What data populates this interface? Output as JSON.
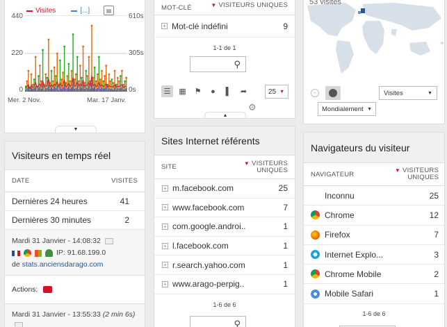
{
  "colors": {
    "accent": "#d4132a",
    "blue": "#255792",
    "visits_series": "#e86b0b",
    "unique_series": "#22b322",
    "dark_series": "#3d3d8f",
    "line_red": "#d4132a",
    "line_blue": "#4b83c3"
  },
  "evolution": {
    "legend_visits": "Visites",
    "legend_other": "[...]",
    "y_left_ticks": [
      "440",
      "220",
      "0"
    ],
    "y_right_ticks": [
      "610s",
      "305s",
      "0s"
    ],
    "x_ticks": [
      "Mer. 2 Nov.",
      "Mar. 17 Janv."
    ]
  },
  "chart_data": {
    "type": "bar",
    "title": "",
    "x_start": "Mer. 2 Nov.",
    "x_end": "Mar. 17 Janv.",
    "ylim": [
      0,
      440
    ],
    "y2lim": [
      0,
      610
    ],
    "series": [
      {
        "name": "Visites",
        "values": [
          30,
          60,
          120,
          20,
          100,
          40,
          70,
          200,
          30,
          90,
          150,
          60,
          240,
          40,
          100,
          80,
          300,
          50,
          120,
          60,
          140,
          90,
          220,
          40,
          180,
          70,
          110,
          260,
          50,
          90,
          160,
          60,
          120,
          330,
          70,
          100,
          200,
          60,
          150,
          80,
          260,
          50,
          120,
          90,
          200,
          60,
          380,
          80,
          140,
          60,
          100,
          200,
          70,
          120,
          60,
          90,
          150,
          40,
          100,
          60,
          70,
          50,
          120,
          40,
          80,
          60,
          90,
          120,
          40,
          60,
          80
        ]
      },
      {
        "name": "[...]",
        "values": [
          10,
          20,
          30,
          10,
          25,
          15,
          20,
          30,
          10,
          20,
          30,
          15,
          35,
          10,
          20,
          20,
          40,
          15,
          25,
          15,
          30,
          20,
          35,
          10,
          30,
          15,
          25,
          40,
          15,
          20,
          30,
          15,
          25,
          45,
          15,
          20,
          35,
          15,
          30,
          20,
          40,
          15,
          25,
          20,
          35,
          15,
          50,
          20,
          30,
          15,
          20,
          35,
          15,
          25,
          15,
          20,
          30,
          10,
          20,
          15,
          15,
          10,
          25,
          10,
          20,
          15,
          20,
          25,
          10,
          15,
          20
        ]
      }
    ]
  },
  "keywords": {
    "col_keyword": "MOT-CLÉ",
    "col_unique": "VISITEURS UNIQUES",
    "rows": [
      {
        "label": "Mot-clé indéfini",
        "value": "9"
      }
    ],
    "pager": "1-1 de 1",
    "limit": "25"
  },
  "map": {
    "visits_count": "53 visites",
    "metric_select": "Visites",
    "region_select": "Mondialement"
  },
  "realtime": {
    "title": "Visiteurs en temps réel",
    "col_date": "DATE",
    "col_visits": "VISITES",
    "rows": [
      {
        "label": "Dernières 24 heures",
        "value": "41"
      },
      {
        "label": "Dernières 30 minutes",
        "value": "2"
      }
    ],
    "visit1_time": "Mardi 31 Janvier - 14:08:32",
    "visit1_ip": "IP: 91.68.199.0",
    "visit1_from": "de",
    "visit1_site": "stats.anciensdarago.com",
    "actions_label": "Actions:",
    "visit2_time": "Mardi 31 Janvier - 13:55:33",
    "visit2_duration": "(2 min 6s)"
  },
  "referrers": {
    "title": "Sites Internet référents",
    "col_site": "SITE",
    "col_unique": "VISITEURS UNIQUES",
    "rows": [
      {
        "label": "m.facebook.com",
        "value": "25"
      },
      {
        "label": "www.facebook.com",
        "value": "7"
      },
      {
        "label": "com.google.androi..",
        "value": "1"
      },
      {
        "label": "l.facebook.com",
        "value": "1"
      },
      {
        "label": "r.search.yahoo.com",
        "value": "1"
      },
      {
        "label": "www.arago-perpig..",
        "value": "1"
      }
    ],
    "pager": "1-6 de 6"
  },
  "browsers": {
    "title": "Navigateurs du visiteur",
    "col_browser": "NAVIGATEUR",
    "col_unique": "VISITEURS UNIQUES",
    "rows": [
      {
        "label": "Inconnu",
        "value": "25",
        "icon": "unknown-icon"
      },
      {
        "label": "Chrome",
        "value": "12",
        "icon": "chrome-icon"
      },
      {
        "label": "Firefox",
        "value": "7",
        "icon": "firefox-icon"
      },
      {
        "label": "Internet Explo...",
        "value": "3",
        "icon": "ie-icon"
      },
      {
        "label": "Chrome Mobile",
        "value": "2",
        "icon": "chrome-icon"
      },
      {
        "label": "Mobile Safari",
        "value": "1",
        "icon": "safari-icon"
      }
    ],
    "pager": "1-6 de 6"
  }
}
